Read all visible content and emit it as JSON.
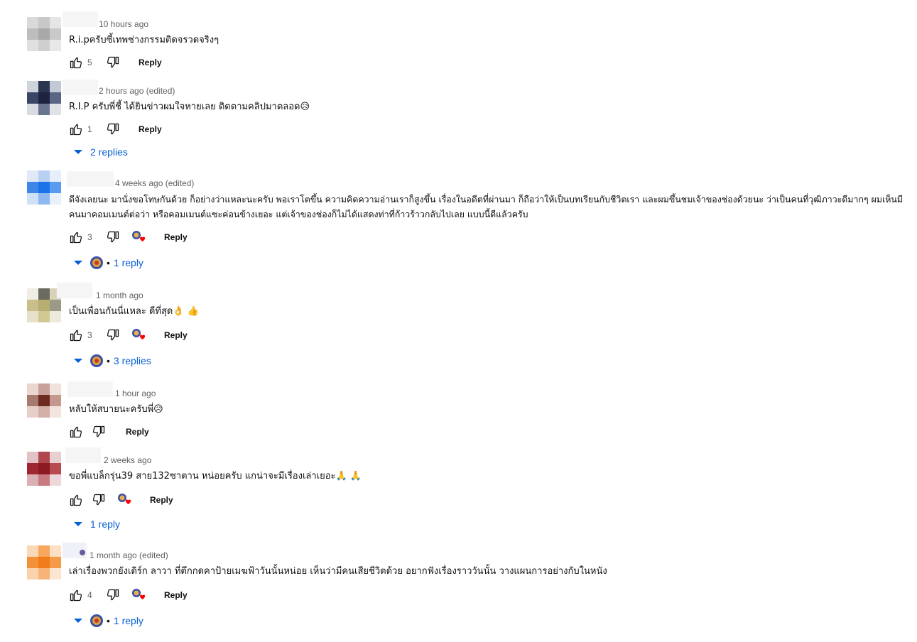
{
  "comments": [
    {
      "time": "10 hours ago",
      "text": "R.i.pครับซี้เทพช่างกรรมติดจรวดจริงๆ",
      "likes": "5",
      "reply_label": "Reply",
      "avatar_colors": [
        "#d9d9d9",
        "#c8c8c8",
        "#e5e5e5",
        "#bdbdbd",
        "#a9a9a9",
        "#c9c9c9",
        "#e0e0e0",
        "#cfcfcf",
        "#e8e8e8"
      ]
    },
    {
      "time": "2 hours ago (edited)",
      "text": "R.I.P ครับพี่ชี้ ได้ยินข่าวผมใจหายเลย ติดตามคลิปมาตลอด😥",
      "likes": "1",
      "reply_label": "Reply",
      "replies_label": "2 replies",
      "avatar_colors": [
        "#cfd3dc",
        "#2b3550",
        "#c3c8d6",
        "#3b4666",
        "#1c2440",
        "#5a6484",
        "#d9dbe2",
        "#6b7590",
        "#e0e2e8"
      ]
    },
    {
      "time": "4 weeks ago (edited)",
      "text": "ดีจังเลยนะ มานั่งขอโทษกันด้วย ก็อย่างว่าแหละนะครับ พอเราโตขึ้น ความคิดความอ่านเราก็สูงขึ้น เรื่องในอดีตที่ผ่านมา ก็ถือว่าให้เป็นบทเรียนกับชีวิตเรา และผมขึ้นชมเจ้าของช่องด้วยนะ ว่าเป็นคนที่วุฒิภาวะดีมากๆ ผมเห็นมีคนมาคอมเมนต์ต่อว่า หรือคอมเมนต์แซะค่อนข้างเยอะ แต่เจ้าของช่องก็ไม่ได้แสดงท่าที่ก้าวร้าวกลับไปเลย แบบนี้ดีแล้วครับ",
      "likes": "3",
      "reply_label": "Reply",
      "replies_label": "1 reply",
      "avatar_colors": [
        "#dfe9f8",
        "#b9d0f2",
        "#e6eefa",
        "#3f86e8",
        "#1a73e8",
        "#5a9af0",
        "#cfe0f7",
        "#8fb8f2",
        "#e8f0fb"
      ]
    },
    {
      "time": "1 month ago",
      "text": "เป็นเพื่อนกันนี่แหละ  ดีที่สุด👌 👍",
      "likes": "3",
      "reply_label": "Reply",
      "replies_label": "3 replies",
      "avatar_colors": [
        "#f0ede4",
        "#6b6b5f",
        "#d8d3b8",
        "#c8bf8a",
        "#b8ae72",
        "#9a9a86",
        "#e6e1c8",
        "#d2c894",
        "#eeeadb"
      ]
    },
    {
      "time": "1 hour ago",
      "text": "หลับให้สบายนะครับพี่😥",
      "likes": "",
      "reply_label": "Reply",
      "avatar_colors": [
        "#ecd6d0",
        "#c8a29a",
        "#efe2dc",
        "#a77a70",
        "#6f2a20",
        "#c4988e",
        "#e6cfc9",
        "#d2b0a8",
        "#f2e4df"
      ]
    },
    {
      "time": "2 weeks ago",
      "text": "ขอพี่แบล็กรุ่น39 สาย132ซาตาน หน่อยครับ แกน่าจะมีเรื่องเล่าเยอะ🙏 🙏",
      "likes": "",
      "reply_label": "Reply",
      "replies_label": "1 reply",
      "avatar_colors": [
        "#e3c2c5",
        "#b0474f",
        "#e8d0d2",
        "#a0262f",
        "#8c1a22",
        "#b84a52",
        "#d9b0b4",
        "#c77a80",
        "#ecd8da"
      ]
    },
    {
      "time": "1 month ago (edited)",
      "text": "เล่าเรื่องพวกยังเดิร์ก ลาวา ที่ตึกกดคาป้ายเมฆฟ้าวันนั้นหน่อย เห็นว่ามีคนเสียชีวิตด้วย อยากฟังเรื่องราววันนั้น วางแผนการอย่างกับในหนัง",
      "likes": "4",
      "reply_label": "Reply",
      "replies_label": "1 reply",
      "avatar_colors": [
        "#fbd9b8",
        "#f7a85c",
        "#fbe0c4",
        "#f39038",
        "#f07c1c",
        "#f59a48",
        "#fad3ac",
        "#f6b478",
        "#fce6d0"
      ]
    }
  ],
  "icons": {
    "like": "thumbs-up-icon",
    "dislike": "thumbs-down-icon",
    "creator_heart": "creator-heart-icon",
    "expand": "caret-down-icon",
    "creator_avatar": "creator-avatar-icon"
  },
  "colors": {
    "link_blue": "#065fd4",
    "secondary_text": "#606060",
    "heart_red": "#ff0000"
  }
}
